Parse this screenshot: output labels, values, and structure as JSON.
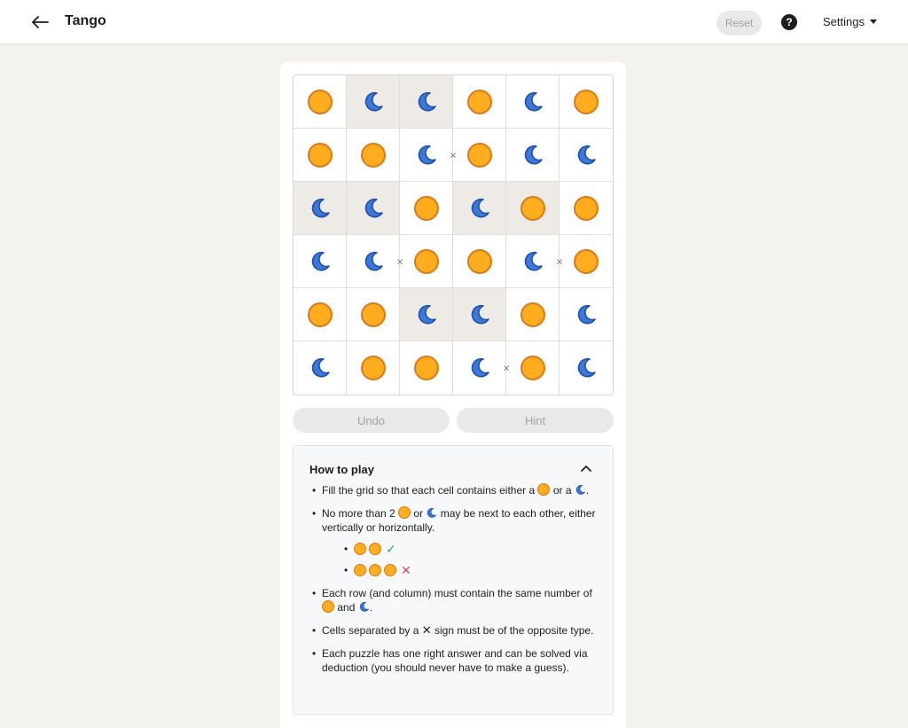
{
  "header": {
    "title": "Tango",
    "reset_label": "Reset",
    "help_label": "?",
    "settings_label": "Settings"
  },
  "board": {
    "size": 6,
    "cells": [
      [
        "sun",
        "moon",
        "moon",
        "sun",
        "moon",
        "sun"
      ],
      [
        "sun",
        "sun",
        "moon",
        "sun",
        "moon",
        "moon"
      ],
      [
        "moon",
        "moon",
        "sun",
        "moon",
        "sun",
        "sun"
      ],
      [
        "moon",
        "moon",
        "sun",
        "sun",
        "moon",
        "sun"
      ],
      [
        "sun",
        "sun",
        "moon",
        "moon",
        "sun",
        "moon"
      ],
      [
        "moon",
        "sun",
        "sun",
        "moon",
        "sun",
        "moon"
      ]
    ],
    "locked": [
      [
        false,
        true,
        true,
        false,
        false,
        false
      ],
      [
        false,
        false,
        false,
        false,
        false,
        false
      ],
      [
        true,
        true,
        false,
        true,
        true,
        false
      ],
      [
        false,
        false,
        false,
        false,
        false,
        false
      ],
      [
        false,
        false,
        true,
        true,
        false,
        false
      ],
      [
        false,
        false,
        false,
        false,
        false,
        false
      ]
    ],
    "separators": [
      {
        "row": 1,
        "col": 2,
        "side": "right",
        "symbol": "×"
      },
      {
        "row": 3,
        "col": 1,
        "side": "right",
        "symbol": "×"
      },
      {
        "row": 3,
        "col": 4,
        "side": "right",
        "symbol": "×"
      },
      {
        "row": 5,
        "col": 3,
        "side": "right",
        "symbol": "×"
      }
    ]
  },
  "controls": {
    "undo_label": "Undo",
    "hint_label": "Hint"
  },
  "howto": {
    "title": "How to play",
    "rule1": {
      "a": "Fill the grid so that each cell contains either a",
      "b": "or a",
      "c": "."
    },
    "rule2": {
      "a": "No more than 2",
      "b": "or",
      "c": "may be next to each other, either vertically or horizontally."
    },
    "rule2_ok": "✓",
    "rule2_bad": "✕",
    "rule3": {
      "a": "Each row (and column) must contain the same number of",
      "b": "and",
      "c": "."
    },
    "rule4": {
      "a": "Cells separated by a",
      "symbol": "✕",
      "b": "sign must be of the opposite type."
    },
    "rule5": "Each puzzle has one right answer and can be solved via deduction (you should never have to make a guess)."
  },
  "colors": {
    "sun_fill": "#ffad1f",
    "sun_stroke": "#d97a1a",
    "moon_fill": "#3b78d8",
    "moon_stroke": "#1f4fa8",
    "locked_cell": "#eeebe6"
  }
}
